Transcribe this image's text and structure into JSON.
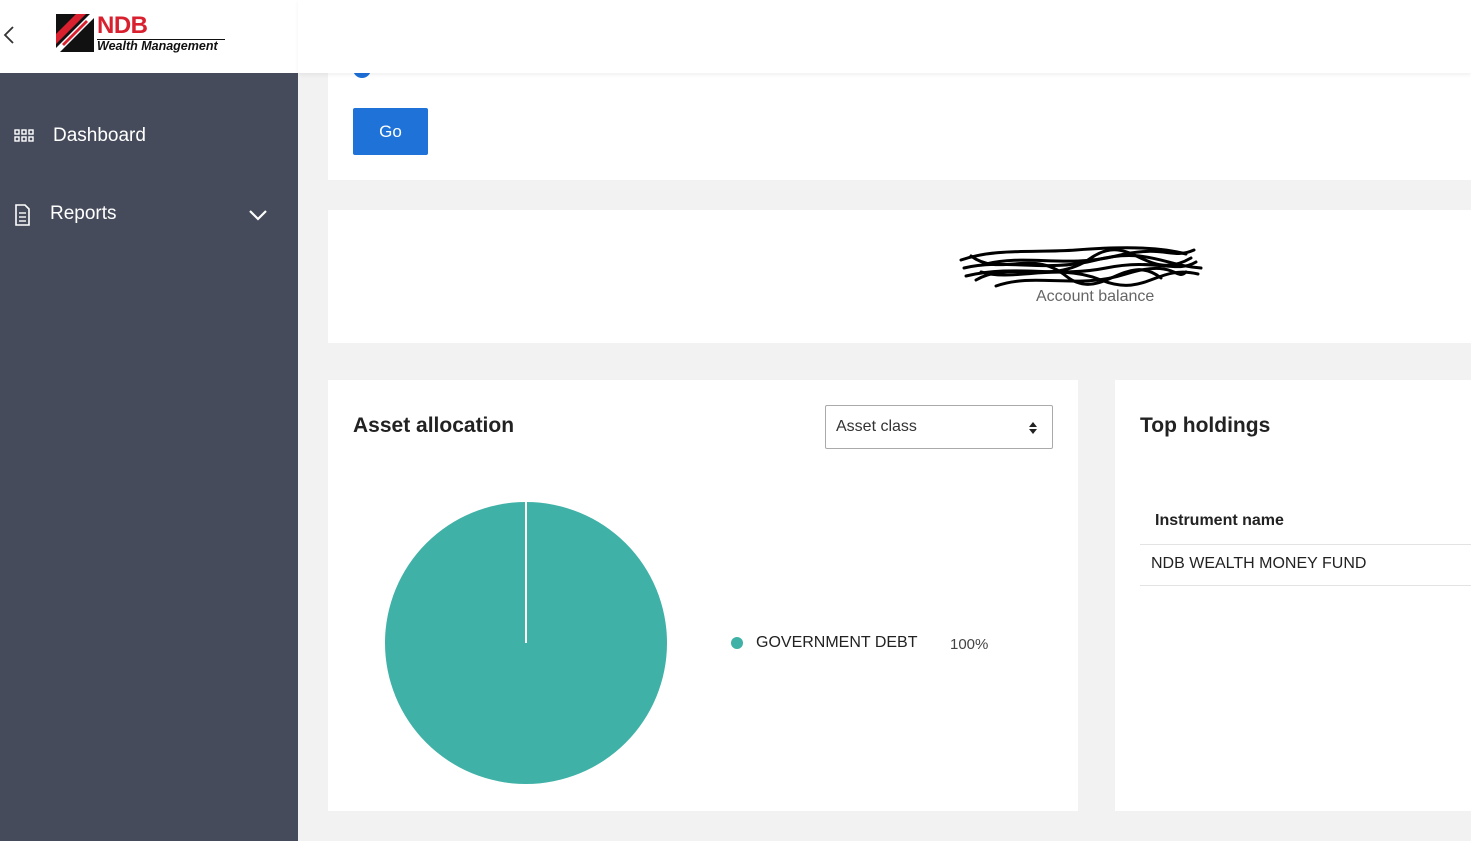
{
  "logo": {
    "brand": "NDB",
    "subtitle": "Wealth Management"
  },
  "sidebar": {
    "items": [
      {
        "label": "Dashboard",
        "icon": "grid-icon"
      },
      {
        "label": "Reports",
        "icon": "document-icon",
        "expandable": true
      }
    ]
  },
  "filter": {
    "go_label": "Go"
  },
  "balance": {
    "label": "Account balance"
  },
  "asset_allocation": {
    "title": "Asset allocation",
    "selector": {
      "value": "Asset class"
    },
    "legend": [
      {
        "label": "GOVERNMENT DEBT",
        "value": "100%"
      }
    ]
  },
  "top_holdings": {
    "title": "Top holdings",
    "columns": [
      "Instrument name"
    ],
    "rows": [
      [
        "NDB WEALTH MONEY FUND"
      ]
    ]
  },
  "colors": {
    "sidebar_bg": "#454b5b",
    "primary_button": "#1f73d8",
    "pie_slice": "#3fb1a7",
    "brand_red": "#d9202f"
  },
  "chart_data": {
    "type": "pie",
    "categories": [
      "GOVERNMENT DEBT"
    ],
    "values": [
      100
    ],
    "colors": [
      "#3fb1a7"
    ]
  }
}
